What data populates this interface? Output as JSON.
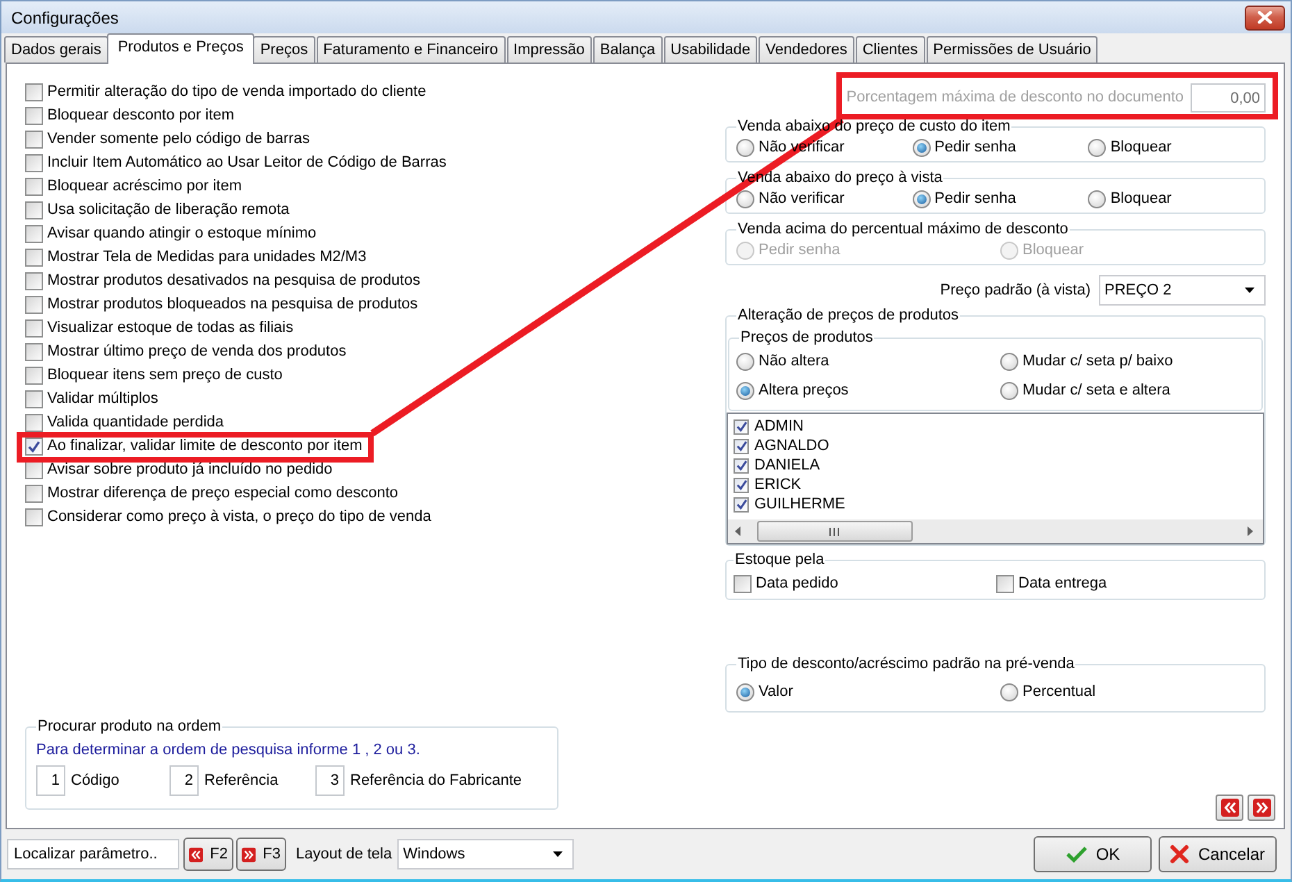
{
  "window": {
    "title": "Configurações"
  },
  "tabs": [
    {
      "label": "Dados gerais",
      "selected": false
    },
    {
      "label": "Produtos e Preços",
      "selected": true
    },
    {
      "label": "Preços",
      "selected": false
    },
    {
      "label": "Faturamento e Financeiro",
      "selected": false
    },
    {
      "label": "Impressão",
      "selected": false
    },
    {
      "label": "Balança",
      "selected": false
    },
    {
      "label": "Usabilidade",
      "selected": false
    },
    {
      "label": "Vendedores",
      "selected": false
    },
    {
      "label": "Clientes",
      "selected": false
    },
    {
      "label": "Permissões de Usuário",
      "selected": false
    }
  ],
  "options": [
    {
      "label": "Permitir alteração do tipo de venda importado do cliente",
      "checked": false,
      "highlighted": false
    },
    {
      "label": "Bloquear desconto por item",
      "checked": false,
      "highlighted": false
    },
    {
      "label": "Vender somente pelo código de barras",
      "checked": false,
      "highlighted": false
    },
    {
      "label": "Incluir Item Automático ao Usar Leitor de Código de Barras",
      "checked": false,
      "highlighted": false
    },
    {
      "label": "Bloquear acréscimo por item",
      "checked": false,
      "highlighted": false
    },
    {
      "label": "Usa solicitação de liberação remota",
      "checked": false,
      "highlighted": false
    },
    {
      "label": "Avisar quando atingir o estoque mínimo",
      "checked": false,
      "highlighted": false
    },
    {
      "label": "Mostrar Tela de Medidas para unidades M2/M3",
      "checked": false,
      "highlighted": false
    },
    {
      "label": "Mostrar produtos desativados na pesquisa de produtos",
      "checked": false,
      "highlighted": false
    },
    {
      "label": "Mostrar produtos bloqueados na pesquisa de produtos",
      "checked": false,
      "highlighted": false
    },
    {
      "label": "Visualizar estoque de todas as filiais",
      "checked": false,
      "highlighted": false
    },
    {
      "label": "Mostrar último preço de venda dos produtos",
      "checked": false,
      "highlighted": false
    },
    {
      "label": "Bloquear itens sem preço de custo",
      "checked": false,
      "highlighted": false
    },
    {
      "label": "Validar múltiplos",
      "checked": false,
      "highlighted": false
    },
    {
      "label": "Valida quantidade perdida",
      "checked": false,
      "highlighted": false
    },
    {
      "label": "Ao finalizar, validar limite de desconto por item",
      "checked": true,
      "highlighted": true
    },
    {
      "label": "Avisar sobre produto já incluído no pedido",
      "checked": false,
      "highlighted": false
    },
    {
      "label": "Mostrar diferença de preço especial como desconto",
      "checked": false,
      "highlighted": false
    },
    {
      "label": "Considerar como preço à vista, o preço do tipo de venda",
      "checked": false,
      "highlighted": false
    }
  ],
  "discount_limit": {
    "label": "Porcentagem máxima de desconto no documento",
    "value": "0,00",
    "disabled": true,
    "highlighted": true
  },
  "radio_groups": [
    {
      "title": "Venda abaixo do preço de custo do item",
      "disabled": false,
      "options": [
        {
          "label": "Não verificar",
          "selected": false
        },
        {
          "label": "Pedir senha",
          "selected": true
        },
        {
          "label": "Bloquear",
          "selected": false
        }
      ]
    },
    {
      "title": "Venda abaixo do preço à vista",
      "disabled": false,
      "options": [
        {
          "label": "Não verificar",
          "selected": false
        },
        {
          "label": "Pedir senha",
          "selected": true
        },
        {
          "label": "Bloquear",
          "selected": false
        }
      ]
    },
    {
      "title": "Venda acima do percentual máximo de desconto",
      "disabled": true,
      "options": [
        {
          "label": "Pedir senha",
          "selected": false
        },
        {
          "label": "Bloquear",
          "selected": false
        }
      ]
    }
  ],
  "default_price": {
    "label": "Preço padrão (à vista)",
    "value": "PREÇO 2"
  },
  "price_changes": {
    "title": "Alteração de preços de produtos",
    "subgroup_title": "Preços de produtos",
    "options": [
      {
        "label": "Não altera",
        "selected": false
      },
      {
        "label": "Mudar c/ seta p/ baixo",
        "selected": false
      },
      {
        "label": "Altera preços",
        "selected": true
      },
      {
        "label": "Mudar c/ seta e altera",
        "selected": false
      }
    ],
    "users": [
      {
        "label": "ADMIN",
        "checked": true
      },
      {
        "label": "AGNALDO",
        "checked": true
      },
      {
        "label": "DANIELA",
        "checked": true
      },
      {
        "label": "ERICK",
        "checked": true
      },
      {
        "label": "GUILHERME",
        "checked": true
      }
    ]
  },
  "stock_by": {
    "title": "Estoque pela",
    "options": [
      {
        "label": "Data pedido",
        "checked": false
      },
      {
        "label": "Data entrega",
        "checked": false
      }
    ]
  },
  "discount_type": {
    "title": "Tipo de desconto/acréscimo padrão na pré-venda",
    "options": [
      {
        "label": "Valor",
        "selected": true
      },
      {
        "label": "Percentual",
        "selected": false
      }
    ]
  },
  "search_order": {
    "title": "Procurar produto na ordem",
    "hint": "Para determinar a ordem de pesquisa informe 1 , 2 ou 3.",
    "fields": [
      {
        "value": "1",
        "label": "Código"
      },
      {
        "value": "2",
        "label": "Referência"
      },
      {
        "value": "3",
        "label": "Referência do Fabricante"
      }
    ]
  },
  "footer": {
    "search": {
      "placeholder": "Localizar parâmetro.."
    },
    "prev_key": "F2",
    "next_key": "F3",
    "layout_label": "Layout de tela",
    "layout_value": "Windows",
    "ok": "OK",
    "cancel": "Cancelar"
  }
}
